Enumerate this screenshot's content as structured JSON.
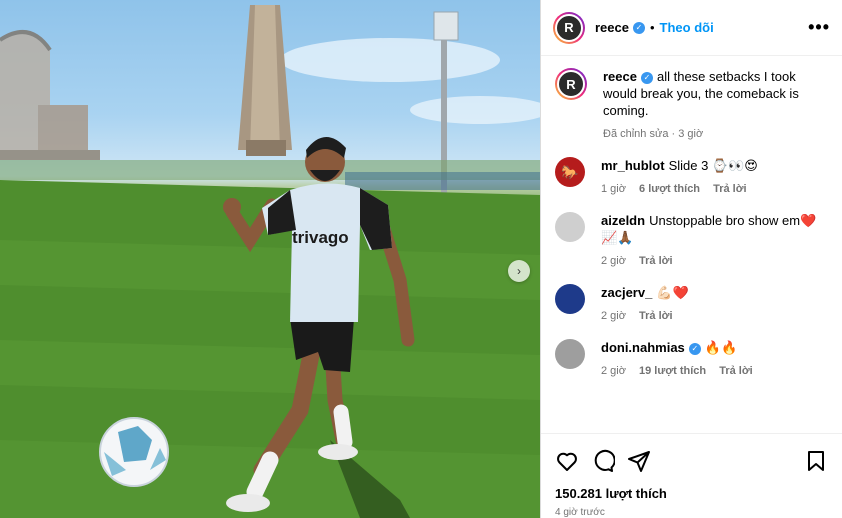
{
  "post": {
    "username": "reece",
    "verified": true,
    "follow_label": "Theo dõi",
    "more_label": "•••",
    "caption": "all these setbacks I took would break you, the comeback is coming.",
    "caption_meta": "Đã chỉnh sửa · 3 giờ",
    "likes": "150.281 lượt thích",
    "posted": "4 giờ trước"
  },
  "photo": {
    "shirt_sponsor": "trivago"
  },
  "comments": [
    {
      "user": "mr_hublot",
      "text": "Slide 3 ⌚👀😍",
      "time": "1 giờ",
      "likes": "6 lượt thích",
      "reply": "Trả lời",
      "avatar_color": "#7a1fa2",
      "avatar_glyph": "🐎"
    },
    {
      "user": "aizeldn",
      "text": "Unstoppable bro show em❤️📈🙏🏾",
      "time": "2 giờ",
      "likes": "",
      "reply": "Trả lời",
      "avatar_color": "#cfcfcf",
      "avatar_glyph": ""
    },
    {
      "user": "zacjerv_",
      "text": "💪🏻❤️",
      "time": "2 giờ",
      "likes": "",
      "reply": "Trả lời",
      "avatar_color": "#1e3a8a",
      "avatar_glyph": ""
    },
    {
      "user": "doni.nahmias",
      "text": "🔥🔥",
      "time": "2 giờ",
      "likes": "19 lượt thích",
      "reply": "Trả lời",
      "avatar_color": "#9e9e9e",
      "avatar_glyph": "",
      "verified": true
    }
  ],
  "icons": {
    "like": "heart-icon",
    "comment": "comment-icon",
    "share": "share-icon",
    "save": "bookmark-icon",
    "next": "chevron-right-icon"
  },
  "colors": {
    "accent": "#0095f6",
    "verified": "#3897f0",
    "muted": "#737373"
  }
}
